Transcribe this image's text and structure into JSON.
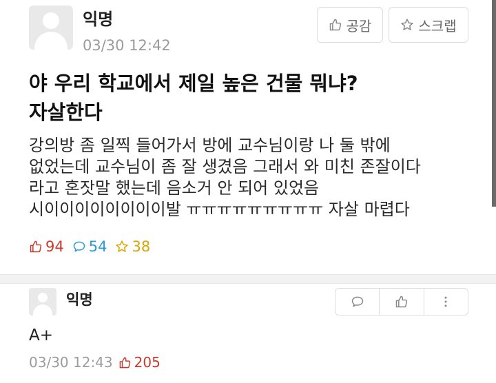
{
  "post": {
    "author": "익명",
    "time": "03/30 12:42",
    "like_button_label": "공감",
    "scrap_button_label": "스크랩",
    "title_line1": "야 우리 학교에서 제일 높은 건물 뭐냐?",
    "title_line2": "자살한다",
    "body_lines": [
      "강의방 좀 일찍 들어가서 방에 교수님이랑 나 둘 밖에",
      "없었는데 교수님이 좀 잘 생겼음 그래서 와 미친 존잘이다",
      "라고 혼잣말 했는데 음소거 안 되어 있었음",
      "시이이이이이이이이발 ㅠㅠㅠㅠㅠㅠㅠㅠㅠ 자살 마렵다"
    ],
    "stats": {
      "likes": "94",
      "comments": "54",
      "scraps": "38"
    }
  },
  "comment": {
    "author": "익명",
    "text": "A+",
    "time": "03/30 12:43",
    "likes": "205"
  },
  "colors": {
    "like": "#c93a2b",
    "comment": "#2b9bd6",
    "scrap": "#d7a600",
    "muted": "#9b9b9b"
  },
  "icons": [
    "thumbs-up-icon",
    "star-icon",
    "speech-bubble-icon",
    "more-vertical-icon",
    "avatar-icon"
  ]
}
